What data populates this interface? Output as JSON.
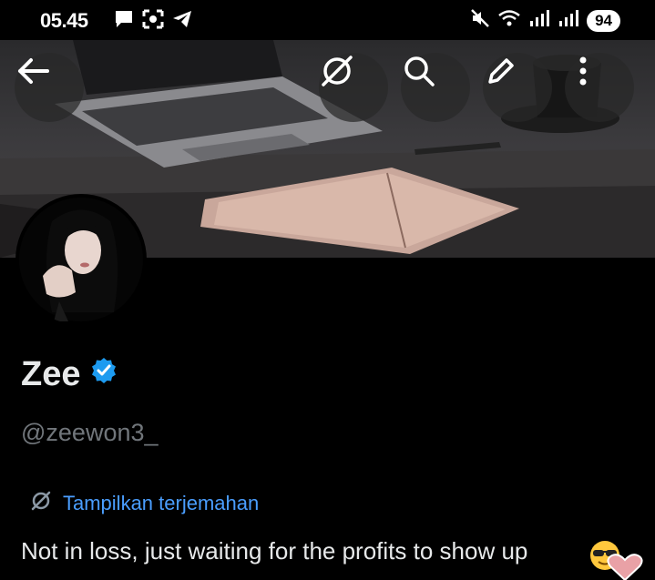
{
  "status_bar": {
    "time": "05.45",
    "battery": "94"
  },
  "profile": {
    "display_name": "Zee",
    "handle": "@zeewon3_",
    "translate_label": "Tampilkan terjemahan",
    "bio": "Not in loss, just waiting for the profits to show up"
  },
  "icons": {
    "back": "back-arrow-icon",
    "grok": "grok-icon",
    "search": "search-icon",
    "edit": "edit-icon",
    "more": "more-vertical-icon",
    "verified": "verified-badge-icon",
    "translate": "grok-translate-icon"
  },
  "colors": {
    "background": "#000000",
    "text": "#e7e9ea",
    "muted": "#71767b",
    "link": "#4a9eff",
    "verified": "#1d9bf0"
  }
}
